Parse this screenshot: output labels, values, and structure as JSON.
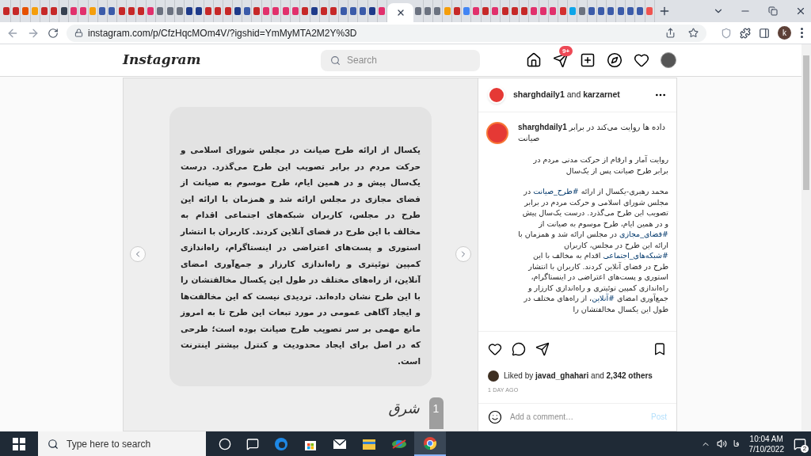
{
  "browser": {
    "tabs": [
      {
        "color": "#c62828",
        "selected": false
      },
      {
        "color": "#c62828",
        "selected": false
      },
      {
        "color": "#e65100",
        "selected": false
      },
      {
        "color": "#f59e0b",
        "selected": false
      },
      {
        "color": "#c62828",
        "selected": false
      },
      {
        "color": "#c62828",
        "selected": false
      },
      {
        "color": "#374151",
        "selected": false
      },
      {
        "color": "#e1306c",
        "selected": false
      },
      {
        "color": "#e1306c",
        "selected": false
      },
      {
        "color": "#f59e0b",
        "selected": false
      },
      {
        "color": "#3b5ba9",
        "selected": false
      },
      {
        "color": "#3b5ba9",
        "selected": false
      },
      {
        "color": "#c62828",
        "selected": false
      },
      {
        "color": "#c62828",
        "selected": false
      },
      {
        "color": "#c62828",
        "selected": false
      },
      {
        "color": "#e1306c",
        "selected": false
      },
      {
        "color": "#6b7280",
        "selected": false
      },
      {
        "color": "#6b7280",
        "selected": false
      },
      {
        "color": "#6b7280",
        "selected": false
      },
      {
        "color": "#1e3a8a",
        "selected": false
      },
      {
        "color": "#1e3a8a",
        "selected": false
      },
      {
        "color": "#c62828",
        "selected": false
      },
      {
        "color": "#c62828",
        "selected": false
      },
      {
        "color": "#c62828",
        "selected": false
      },
      {
        "color": "#1e3a8a",
        "selected": false
      },
      {
        "color": "#3b5ba9",
        "selected": false
      },
      {
        "color": "#c62828",
        "selected": false
      },
      {
        "color": "#e1306c",
        "selected": false
      },
      {
        "color": "#e1306c",
        "selected": false
      },
      {
        "color": "#e1306c",
        "selected": false
      },
      {
        "color": "#e1306c",
        "selected": false
      },
      {
        "color": "#c62828",
        "selected": false
      },
      {
        "color": "#1e3a8a",
        "selected": false
      },
      {
        "color": "#c62828",
        "selected": false
      },
      {
        "color": "#c62828",
        "selected": false
      },
      {
        "color": "#3b5ba9",
        "selected": false
      },
      {
        "color": "#3b5ba9",
        "selected": false
      },
      {
        "color": "#3b5ba9",
        "selected": false
      },
      {
        "color": "#1e3a8a",
        "selected": false
      },
      {
        "color": "#e1306c",
        "selected": false
      },
      {
        "selected": true
      },
      {
        "color": "#6b7280",
        "selected": false
      },
      {
        "color": "#6b7280",
        "selected": false
      },
      {
        "color": "#6b7280",
        "selected": false
      },
      {
        "color": "#f59e0b",
        "selected": false
      },
      {
        "color": "#c62828",
        "selected": false
      },
      {
        "color": "#4285f4",
        "selected": false
      },
      {
        "color": "#e1306c",
        "selected": false
      },
      {
        "color": "#c62828",
        "selected": false
      },
      {
        "color": "#e1306c",
        "selected": false
      },
      {
        "color": "#c62828",
        "selected": false
      },
      {
        "color": "#c62828",
        "selected": false
      },
      {
        "color": "#c62828",
        "selected": false
      },
      {
        "color": "#e1306c",
        "selected": false
      },
      {
        "color": "#e1306c",
        "selected": false
      },
      {
        "color": "#e1306c",
        "selected": false
      },
      {
        "color": "#d32f2f",
        "selected": false
      },
      {
        "color": "#0ea5e9",
        "selected": false
      },
      {
        "color": "#6b7280",
        "selected": false
      },
      {
        "color": "#3b5ba9",
        "selected": false
      },
      {
        "color": "#3b5ba9",
        "selected": false
      },
      {
        "color": "#3b5ba9",
        "selected": false
      },
      {
        "color": "#3b5ba9",
        "selected": false
      },
      {
        "color": "#3b5ba9",
        "selected": false
      },
      {
        "color": "#3b5ba9",
        "selected": false
      },
      {
        "color": "#ef5350",
        "selected": false
      }
    ],
    "url": "instagram.com/p/CfzHqcMOm4V/?igshid=YmMyMTA2M2Y%3D",
    "profile": "k"
  },
  "instagram": {
    "logo": "Instagram",
    "search_placeholder": "Search",
    "direct_badge": "9+"
  },
  "post": {
    "image_text": "یکسال از ارائه طرح صیانت در مجلس شورای اسلامی و حرکت مردم در برابر تصویب این طرح می‌گذرد. درست یک‌سال پیش و در همین ایام، طرح موسوم به صیانت از فضای مجازی در مجلس ارائه شد و همزمان با ارائه این طرح در مجلس، کاربران شبکه‌های اجتماعی اقدام به مخالف با این طرح در فضای آنلاین کردند. کاربران با انتشار استوری و پست‌های اعتراضی در اینستاگرام، راه‌اندازی کمپین توئیتری و راه‌اندازی کارزار و جمع‌آوری امضای آنلاین، از راه‌های مختلف در طول این یکسال مخالفتشان را با این طرح نشان داده‌اند. تردیدی نیست که این مخالفت‌ها و ایجاد آگاهی عمومی در مورد تبعات این طرح تا به امروز مانع مهمی بر سر تصویب طرح صیانت بوده است؛ طرحی که در اصل برای ایجاد محدودیت و کنترل بیشتر اینترنت است.",
    "page_number": "1",
    "logo_text": "شرق"
  },
  "panel": {
    "header": "**sharghdaily1** and **karzarnet**",
    "caption": {
      "username": "sharghdaily1",
      "title": "داده ها روایت می‌کند در برابر صیانت",
      "subtitle": "روایت آمار و ارقام از حرکت مدنی مردم در برابر طرح صیانت پس از یک‌سال",
      "body": [
        {
          "kind": "plain",
          "text": "محمد رهبری-یکسال از ارائه "
        },
        {
          "kind": "hashtag",
          "text": "#طرح_صیانت"
        },
        {
          "kind": "plain",
          "text": " در مجلس شورای اسلامی و حرکت مردم در برابر تصویب این طرح می‌گذرد. درست یک‌سال پیش و در همین ایام، طرح موسوم به صیانت از "
        },
        {
          "kind": "hashtag",
          "text": "#فضای_مجازی"
        },
        {
          "kind": "plain",
          "text": " در مجلس ارائه شد و همزمان با ارائه این طرح در مجلس، کاربران "
        },
        {
          "kind": "hashtag",
          "text": "#شبکه‌های_اجتماعی"
        },
        {
          "kind": "plain",
          "text": " اقدام به مخالف با این طرح در فضای آنلاین کردند. کاربران با انتشار استوری و پست‌های اعتراضی در اینستاگرام، راه‌اندازی کمپین توئیتری و راه‌اندازی کارزار و جمع‌آوری امضای "
        },
        {
          "kind": "hashtag",
          "text": "#آنلاین"
        },
        {
          "kind": "plain",
          "text": "، از راه‌های مختلف در طول این یکسال مخالفتشان را"
        }
      ]
    },
    "likes": "Liked by **javad_ghahari** and **2,342 others**",
    "time": "1 DAY AGO",
    "comment_placeholder": "Add a comment…",
    "post_button": {
      "label": "Post",
      "disabled": true
    }
  },
  "taskbar": {
    "search_placeholder": "Type here to search",
    "language": "فا",
    "time": "10:04 AM",
    "date": "7/10/2022",
    "notifications": "2"
  }
}
